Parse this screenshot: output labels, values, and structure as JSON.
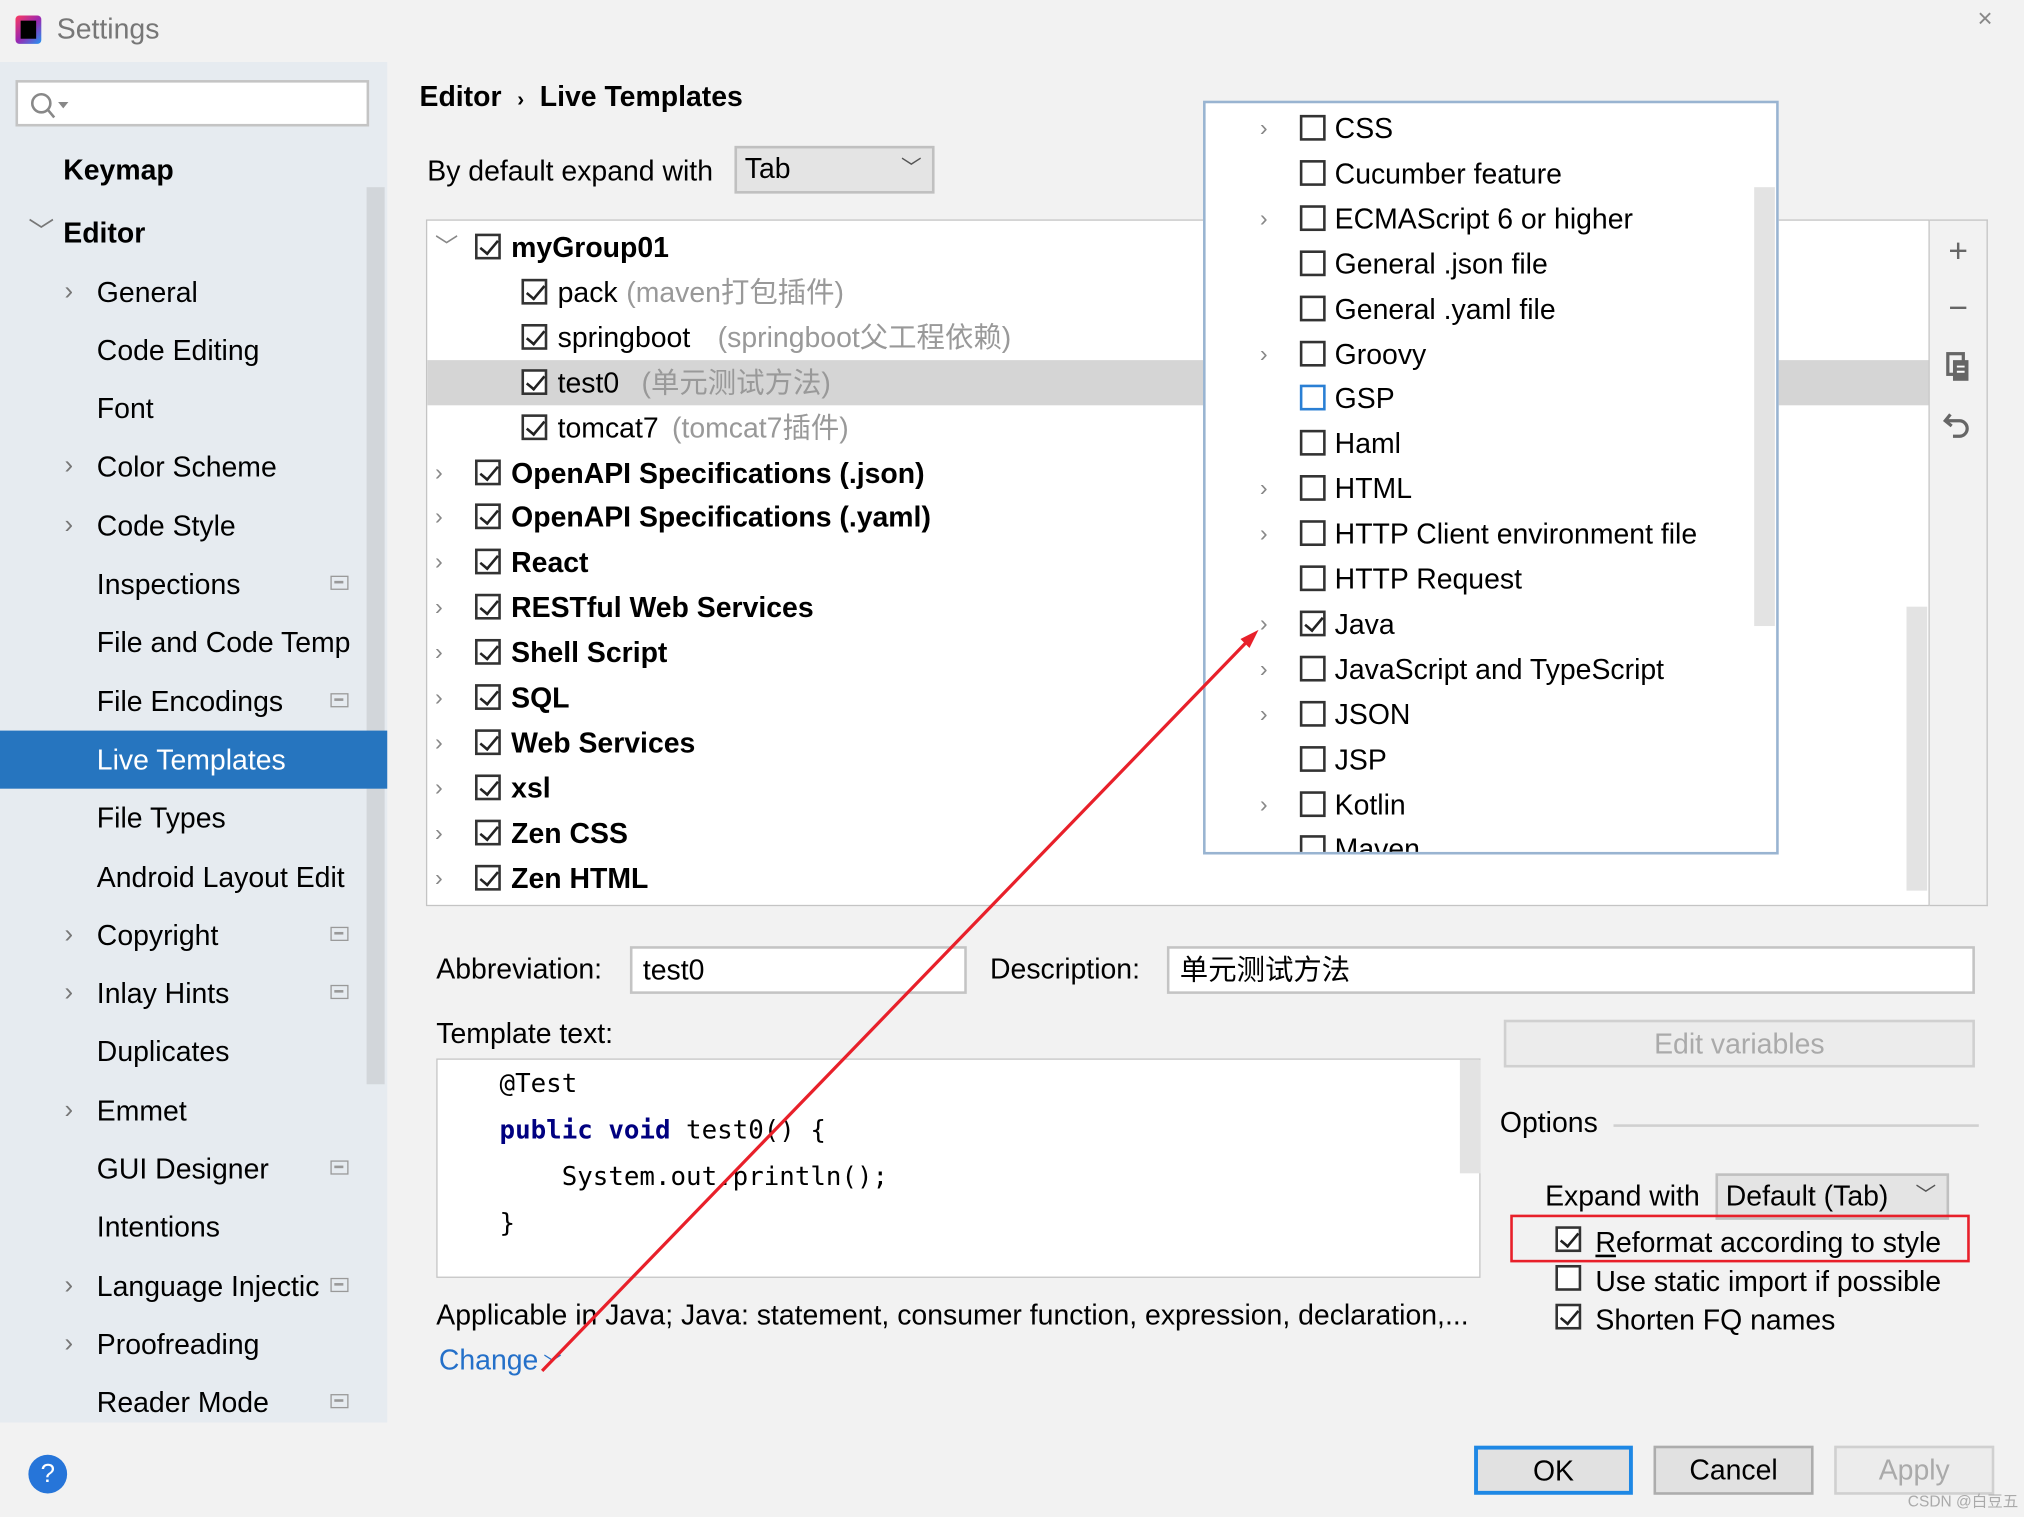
{
  "window": {
    "title": "Settings",
    "close": "×"
  },
  "sidebar": {
    "search_placeholder": "",
    "items": [
      {
        "label": "Keymap",
        "top": true
      },
      {
        "label": "Editor",
        "top": true,
        "expanded": true
      },
      {
        "label": "General",
        "chevron": true
      },
      {
        "label": "Code Editing"
      },
      {
        "label": "Font"
      },
      {
        "label": "Color Scheme",
        "chevron": true
      },
      {
        "label": "Code Style",
        "chevron": true
      },
      {
        "label": "Inspections",
        "page_icon": true
      },
      {
        "label": "File and Code Temp"
      },
      {
        "label": "File Encodings",
        "page_icon": true
      },
      {
        "label": "Live Templates",
        "selected": true
      },
      {
        "label": "File Types"
      },
      {
        "label": "Android Layout Edit"
      },
      {
        "label": "Copyright",
        "chevron": true,
        "page_icon": true
      },
      {
        "label": "Inlay Hints",
        "chevron": true,
        "page_icon": true
      },
      {
        "label": "Duplicates"
      },
      {
        "label": "Emmet",
        "chevron": true
      },
      {
        "label": "GUI Designer",
        "page_icon": true
      },
      {
        "label": "Intentions"
      },
      {
        "label": "Language Injectic",
        "chevron": true,
        "page_icon": true
      },
      {
        "label": "Proofreading",
        "chevron": true
      },
      {
        "label": "Reader Mode",
        "page_icon": true
      }
    ]
  },
  "breadcrumb": {
    "parent": "Editor",
    "sep": "›",
    "current": "Live Templates"
  },
  "expand_default": {
    "label": "By default expand with",
    "value": "Tab"
  },
  "tree": [
    {
      "name": "myGroup01",
      "checked": true,
      "group": true,
      "expanded": true
    },
    {
      "name": "pack",
      "desc": "(maven打包插件)",
      "checked": true
    },
    {
      "name": "springboot",
      "desc": "(springboot父工程依赖)",
      "checked": true
    },
    {
      "name": "test0",
      "desc": "(单元测试方法)",
      "checked": true,
      "selected": true
    },
    {
      "name": "tomcat7",
      "desc": "(tomcat7插件)",
      "checked": true
    },
    {
      "name": "OpenAPI Specifications (.json)",
      "checked": true,
      "group": true
    },
    {
      "name": "OpenAPI Specifications (.yaml)",
      "checked": true,
      "group": true
    },
    {
      "name": "React",
      "checked": true,
      "group": true
    },
    {
      "name": "RESTful Web Services",
      "checked": true,
      "group": true
    },
    {
      "name": "Shell Script",
      "checked": true,
      "group": true
    },
    {
      "name": "SQL",
      "checked": true,
      "group": true
    },
    {
      "name": "Web Services",
      "checked": true,
      "group": true
    },
    {
      "name": "xsl",
      "checked": true,
      "group": true
    },
    {
      "name": "Zen CSS",
      "checked": true,
      "group": true
    },
    {
      "name": "Zen HTML",
      "checked": true,
      "group": true
    }
  ],
  "toolbar": {
    "add": "+",
    "remove": "−",
    "copy": "copy-icon",
    "restore": "undo-icon"
  },
  "contexts_popup": [
    {
      "name": "CSS",
      "chevron": true,
      "checked": false
    },
    {
      "name": "Cucumber feature",
      "checked": false
    },
    {
      "name": "ECMAScript 6 or higher",
      "chevron": true,
      "checked": false
    },
    {
      "name": "General .json file",
      "checked": false
    },
    {
      "name": "General .yaml file",
      "checked": false
    },
    {
      "name": "Groovy",
      "chevron": true,
      "checked": false
    },
    {
      "name": "GSP",
      "checked": false,
      "focused": true
    },
    {
      "name": "Haml",
      "checked": false
    },
    {
      "name": "HTML",
      "chevron": true,
      "checked": false
    },
    {
      "name": "HTTP Client environment file",
      "chevron": true,
      "checked": false
    },
    {
      "name": "HTTP Request",
      "checked": false
    },
    {
      "name": "Java",
      "chevron": true,
      "checked": true
    },
    {
      "name": "JavaScript and TypeScript",
      "chevron": true,
      "checked": false
    },
    {
      "name": "JSON",
      "chevron": true,
      "checked": false
    },
    {
      "name": "JSP",
      "checked": false
    },
    {
      "name": "Kotlin",
      "chevron": true,
      "checked": false
    },
    {
      "name": "Maven",
      "checked": false
    }
  ],
  "form": {
    "abbreviation_label": "Abbreviation:",
    "abbreviation": "test0",
    "description_label": "Description:",
    "description": "单元测试方法",
    "template_text_label": "Template text:",
    "code": [
      "@Test",
      "public void test0() {",
      "    System.out.println();",
      "}"
    ],
    "edit_variables": "Edit variables",
    "applicable": "Applicable in Java; Java: statement, consumer function, expression, declaration,...",
    "change": "Change"
  },
  "options": {
    "title": "Options",
    "expand_label": "Expand with",
    "expand_value": "Default (Tab)",
    "reformat": {
      "label": "Reformat according to style",
      "checked": true
    },
    "static_import": {
      "label": "Use static import if possible",
      "checked": false
    },
    "shorten_fq": {
      "label": "Shorten FQ names",
      "checked": true
    }
  },
  "buttons": {
    "ok": "OK",
    "cancel": "Cancel",
    "apply": "Apply",
    "help": "?"
  },
  "annotation_color": "#e8202a",
  "watermark": "CSDN @白豆五"
}
